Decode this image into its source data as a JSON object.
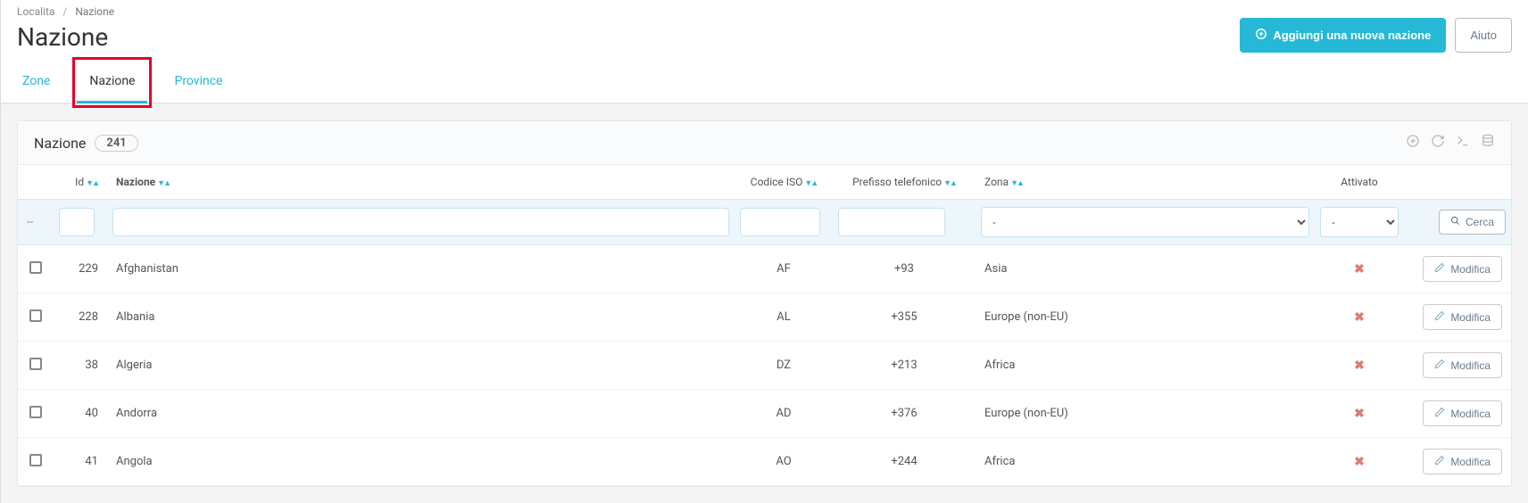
{
  "breadcrumb": {
    "parent": "Localita",
    "current": "Nazione"
  },
  "page_title": "Nazione",
  "header": {
    "add_label": "Aggiungi una nuova nazione",
    "help_label": "Aiuto"
  },
  "tabs": [
    {
      "label": "Zone",
      "active": false
    },
    {
      "label": "Nazione",
      "active": true
    },
    {
      "label": "Province",
      "active": false
    }
  ],
  "panel": {
    "title": "Nazione",
    "count": "241",
    "search_label": "Cerca"
  },
  "columns": {
    "id": "Id",
    "nazione": "Nazione",
    "iso": "Codice ISO",
    "prefix": "Prefisso telefonico",
    "zona": "Zona",
    "attivato": "Attivato"
  },
  "filter_placeholders": {
    "zona": "-",
    "attivato": "-"
  },
  "row_action_label": "Modifica",
  "rows": [
    {
      "id": "229",
      "name": "Afghanistan",
      "iso": "AF",
      "prefix": "+93",
      "zone": "Asia",
      "active": false
    },
    {
      "id": "228",
      "name": "Albania",
      "iso": "AL",
      "prefix": "+355",
      "zone": "Europe (non-EU)",
      "active": false
    },
    {
      "id": "38",
      "name": "Algeria",
      "iso": "DZ",
      "prefix": "+213",
      "zone": "Africa",
      "active": false
    },
    {
      "id": "40",
      "name": "Andorra",
      "iso": "AD",
      "prefix": "+376",
      "zone": "Europe (non-EU)",
      "active": false
    },
    {
      "id": "41",
      "name": "Angola",
      "iso": "AO",
      "prefix": "+244",
      "zone": "Africa",
      "active": false
    }
  ]
}
